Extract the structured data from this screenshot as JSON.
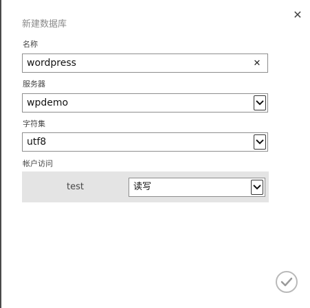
{
  "dialog": {
    "title": "新建数据库"
  },
  "fields": {
    "name": {
      "label": "名称",
      "value": "wordpress"
    },
    "server": {
      "label": "服务器",
      "value": "wpdemo"
    },
    "charset": {
      "label": "字符集",
      "value": "utf8"
    }
  },
  "access": {
    "label": "帐户访问",
    "user": "test",
    "permission": "读写"
  },
  "icons": {
    "close": "close-icon",
    "clear": "clear-icon",
    "dropdown": "chevron-down-icon",
    "confirm": "check-icon"
  }
}
